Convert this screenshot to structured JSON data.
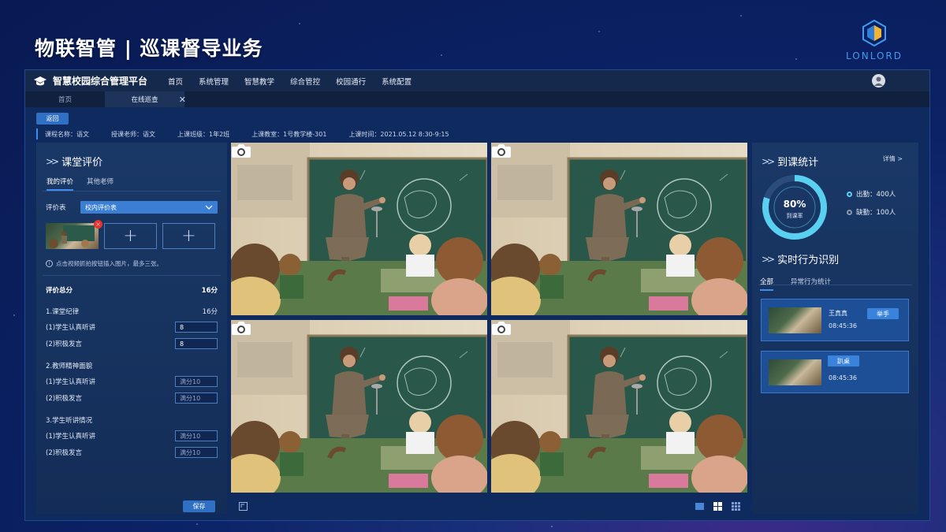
{
  "slide": {
    "title": "物联智管 | 巡课督导业务",
    "logo_text": "LONLORD"
  },
  "app": {
    "brand": "智慧校园综合管理平台",
    "nav": [
      "首页",
      "系统管理",
      "智慧教学",
      "综合管控",
      "校园通行",
      "系统配置"
    ],
    "tabs": [
      {
        "label": "首页",
        "active": false
      },
      {
        "label": "在线巡查",
        "active": true,
        "close": "✕"
      }
    ],
    "back_label": "返回",
    "info": [
      "课程名称：语文",
      "授课老师：语文",
      "上课班级：1年2班",
      "上课教室：1号教学楼-301",
      "上课时间：2021.05.12  8:30-9:15"
    ]
  },
  "evaluation": {
    "title": "课堂评价",
    "subtabs": [
      {
        "label": "我的评价",
        "active": true
      },
      {
        "label": "其他老师",
        "active": false
      }
    ],
    "form_label": "评价表",
    "form_value": "校内评价表",
    "add_symbol": "+",
    "remove_symbol": "×",
    "hint_icon": "i",
    "hint": "点击视频抓拍按钮插入图片，最多三张。",
    "total_label": "评价总分",
    "total_value": "16分",
    "sections": [
      {
        "title": "1.课堂纪律",
        "score": "16分",
        "items": [
          {
            "label": "(1)学生认真听讲",
            "value": "8",
            "placeholder": ""
          },
          {
            "label": "(2)积极发言",
            "value": "8",
            "placeholder": ""
          }
        ]
      },
      {
        "title": "2.教师精神面貌",
        "score": "",
        "items": [
          {
            "label": "(1)学生认真听讲",
            "value": "",
            "placeholder": "满分10"
          },
          {
            "label": "(2)积极发言",
            "value": "",
            "placeholder": "满分10"
          }
        ]
      },
      {
        "title": "3.学生听讲情况",
        "score": "",
        "items": [
          {
            "label": "(1)学生认真听讲",
            "value": "",
            "placeholder": "满分10"
          },
          {
            "label": "(2)积极发言",
            "value": "",
            "placeholder": "满分10"
          }
        ]
      }
    ],
    "save_label": "保存"
  },
  "attendance": {
    "title": "到课统计",
    "detail_link": "详情 >",
    "rate_value": "80%",
    "rate_label": "到课率",
    "rate_fraction": 0.8,
    "present": "出勤：400人",
    "absent": "缺勤：100人",
    "colors": {
      "ring": "#5ad0f0",
      "track": "#2b4d7e"
    }
  },
  "behavior": {
    "title": "实时行为识别",
    "subtabs": [
      {
        "label": "全部",
        "active": true
      },
      {
        "label": "异常行为统计",
        "active": false
      }
    ],
    "alerts": [
      {
        "name": "王真真",
        "time": "08:45:36",
        "tag": "举手"
      },
      {
        "name": "",
        "time": "08:45:36",
        "tag": "趴桌"
      }
    ]
  }
}
